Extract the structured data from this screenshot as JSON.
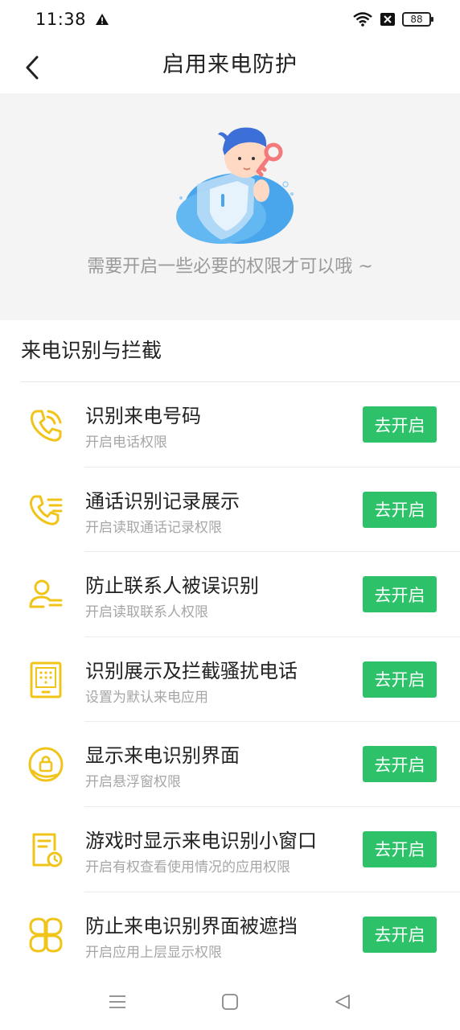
{
  "status_bar": {
    "time": "11:38",
    "battery": "88",
    "icons": [
      "alert-icon",
      "wifi-icon",
      "sim-off-icon",
      "battery-icon"
    ]
  },
  "header": {
    "title": "启用来电防护",
    "back_icon": "chevron-left-icon"
  },
  "hero": {
    "message": "需要开启一些必要的权限才可以哦 ~"
  },
  "section": {
    "title": "来电识别与拦截"
  },
  "colors": {
    "accent_green": "#2dc269",
    "icon_yellow": "#f0c419"
  },
  "permissions": [
    {
      "title": "识别来电号码",
      "desc": "开启电话权限",
      "button": "去开启",
      "icon": "phone-icon"
    },
    {
      "title": "通话识别记录展示",
      "desc": "开启读取通话记录权限",
      "button": "去开启",
      "icon": "call-log-icon"
    },
    {
      "title": "防止联系人被误识别",
      "desc": "开启读取联系人权限",
      "button": "去开启",
      "icon": "contacts-icon"
    },
    {
      "title": "识别展示及拦截骚扰电话",
      "desc": "设置为默认来电应用",
      "button": "去开启",
      "icon": "dialpad-icon"
    },
    {
      "title": "显示来电识别界面",
      "desc": "开启悬浮窗权限",
      "button": "去开启",
      "icon": "lock-circle-icon"
    },
    {
      "title": "游戏时显示来电识别小窗口",
      "desc": "开启有权查看使用情况的应用权限",
      "button": "去开启",
      "icon": "usage-clock-icon"
    },
    {
      "title": "防止来电识别界面被遮挡",
      "desc": "开启应用上层显示权限",
      "button": "去开启",
      "icon": "overlay-icon"
    }
  ],
  "nav_bar": {
    "icons": [
      "menu-icon",
      "home-icon",
      "back-icon"
    ]
  }
}
